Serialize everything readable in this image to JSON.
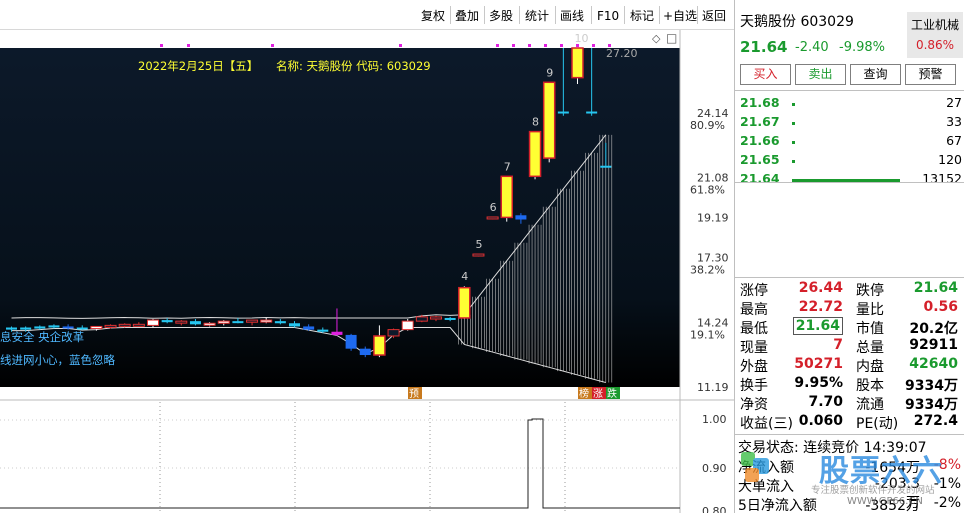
{
  "toolbar": {
    "items": [
      "复权",
      "叠加",
      "多股",
      "统计",
      "画线",
      "F10",
      "标记",
      "+自选",
      "返回"
    ]
  },
  "chart_info": {
    "date": "2022年2月25日【五】",
    "name_code": "名称: 天鹅股份 代码: 603029",
    "note1": "息安全 央企改革",
    "note2": "线进网小心，蓝色忽略",
    "pct_labels": [
      {
        "price": 24.14,
        "pct": "80.9%"
      },
      {
        "price": 21.08,
        "pct": "61.8%"
      },
      {
        "price": 17.3,
        "pct": "38.2%"
      },
      {
        "price": 14.24,
        "pct": "19.1%"
      }
    ],
    "step_labels": [
      "4",
      "5",
      "6",
      "7",
      "8",
      "9",
      "10"
    ],
    "top_price_label": "27.20",
    "bottom_tags": [
      "预",
      "榜",
      "涨",
      "跌"
    ],
    "sub_axis": [
      "1.00",
      "0.90",
      "0.80"
    ]
  },
  "chart_data": {
    "type": "candlestick",
    "title": "2022年2月25日【五】 名称: 天鹅股份 代码: 603029",
    "y_ticks": [
      24.14,
      21.08,
      19.19,
      17.3,
      14.24,
      11.19
    ],
    "ylim": [
      11.19,
      27.2
    ],
    "candles": [
      {
        "o": 14.0,
        "h": 14.05,
        "l": 13.8,
        "c": 13.9,
        "c_type": "cyan"
      },
      {
        "o": 14.0,
        "h": 14.05,
        "l": 13.8,
        "c": 13.9,
        "c_type": "cyan"
      },
      {
        "o": 14.05,
        "h": 14.1,
        "l": 13.9,
        "c": 13.95,
        "c_type": "cyan"
      },
      {
        "o": 14.1,
        "h": 14.15,
        "l": 13.95,
        "c": 14.0,
        "c_type": "cyan"
      },
      {
        "o": 14.05,
        "h": 14.15,
        "l": 13.9,
        "c": 14.05,
        "c_type": "blue"
      },
      {
        "o": 14.0,
        "h": 14.1,
        "l": 13.9,
        "c": 13.95,
        "c_type": "cyan"
      },
      {
        "o": 13.95,
        "h": 14.05,
        "l": 13.85,
        "c": 14.05,
        "c_type": "white"
      },
      {
        "o": 14.05,
        "h": 14.15,
        "l": 13.95,
        "c": 14.1,
        "c_type": "red"
      },
      {
        "o": 14.1,
        "h": 14.2,
        "l": 14.0,
        "c": 14.15,
        "c_type": "red"
      },
      {
        "o": 14.15,
        "h": 14.25,
        "l": 14.05,
        "c": 14.1,
        "c_type": "red"
      },
      {
        "o": 14.1,
        "h": 14.4,
        "l": 14.0,
        "c": 14.35,
        "c_type": "white"
      },
      {
        "o": 14.35,
        "h": 14.45,
        "l": 14.2,
        "c": 14.25,
        "c_type": "cyan"
      },
      {
        "o": 14.25,
        "h": 14.35,
        "l": 14.1,
        "c": 14.3,
        "c_type": "red"
      },
      {
        "o": 14.3,
        "h": 14.4,
        "l": 14.1,
        "c": 14.15,
        "c_type": "cyan"
      },
      {
        "o": 14.15,
        "h": 14.25,
        "l": 14.05,
        "c": 14.2,
        "c_type": "white"
      },
      {
        "o": 14.2,
        "h": 14.35,
        "l": 14.1,
        "c": 14.3,
        "c_type": "white"
      },
      {
        "o": 14.3,
        "h": 14.45,
        "l": 14.2,
        "c": 14.25,
        "c_type": "cyan"
      },
      {
        "o": 14.25,
        "h": 14.35,
        "l": 14.1,
        "c": 14.35,
        "c_type": "red"
      },
      {
        "o": 14.35,
        "h": 14.45,
        "l": 14.2,
        "c": 14.3,
        "c_type": "white"
      },
      {
        "o": 14.3,
        "h": 14.4,
        "l": 14.15,
        "c": 14.2,
        "c_type": "cyan"
      },
      {
        "o": 14.2,
        "h": 14.3,
        "l": 14.0,
        "c": 14.05,
        "c_type": "cyan"
      },
      {
        "o": 14.05,
        "h": 14.15,
        "l": 13.85,
        "c": 13.9,
        "c_type": "blue"
      },
      {
        "o": 13.9,
        "h": 14.0,
        "l": 13.75,
        "c": 13.8,
        "c_type": "cyan"
      },
      {
        "o": 13.8,
        "h": 14.9,
        "l": 13.6,
        "c": 13.65,
        "c_type": "magenta"
      },
      {
        "o": 13.65,
        "h": 13.7,
        "l": 12.9,
        "c": 13.0,
        "c_type": "blue"
      },
      {
        "o": 13.0,
        "h": 13.1,
        "l": 12.6,
        "c": 12.7,
        "c_type": "blue"
      },
      {
        "o": 12.7,
        "h": 14.1,
        "l": 12.6,
        "c": 13.6,
        "c_type": "yellow"
      },
      {
        "o": 13.6,
        "h": 13.95,
        "l": 13.5,
        "c": 13.9,
        "c_type": "red"
      },
      {
        "o": 13.9,
        "h": 14.4,
        "l": 13.85,
        "c": 14.3,
        "c_type": "white"
      },
      {
        "o": 14.3,
        "h": 14.6,
        "l": 14.25,
        "c": 14.5,
        "c_type": "red"
      },
      {
        "o": 14.5,
        "h": 14.55,
        "l": 14.3,
        "c": 14.4,
        "c_type": "red"
      },
      {
        "o": 14.4,
        "h": 14.5,
        "l": 14.3,
        "c": 14.45,
        "c_type": "cyan"
      },
      {
        "o": 14.45,
        "h": 15.95,
        "l": 14.4,
        "c": 15.88,
        "c_type": "yellow"
      },
      {
        "o": 17.47,
        "h": 17.47,
        "l": 17.35,
        "c": 17.47,
        "c_type": "red"
      },
      {
        "o": 19.2,
        "h": 19.22,
        "l": 19.1,
        "c": 19.22,
        "c_type": "red"
      },
      {
        "o": 19.2,
        "h": 21.14,
        "l": 19.0,
        "c": 21.14,
        "c_type": "yellow"
      },
      {
        "o": 19.1,
        "h": 19.4,
        "l": 18.9,
        "c": 19.3,
        "c_type": "blue"
      },
      {
        "o": 21.14,
        "h": 23.25,
        "l": 21.0,
        "c": 23.25,
        "c_type": "yellow"
      },
      {
        "o": 22.0,
        "h": 25.58,
        "l": 21.8,
        "c": 25.58,
        "c_type": "yellow"
      },
      {
        "o": 24.2,
        "h": 27.2,
        "l": 24.0,
        "c": 24.2,
        "c_type": "cyan"
      },
      {
        "o": 25.8,
        "h": 27.2,
        "l": 25.5,
        "c": 27.2,
        "c_type": "yellow"
      },
      {
        "o": 24.2,
        "h": 27.2,
        "l": 24.0,
        "c": 24.2,
        "c_type": "cyan"
      },
      {
        "o": 21.64,
        "h": 22.72,
        "l": 21.64,
        "c": 21.64,
        "c_type": "cyan"
      }
    ],
    "volume_note": "sub-panel shows a tall bar near the recent candles"
  },
  "stock": {
    "name": "天鹅股份",
    "code": "603029",
    "price": "21.64",
    "change": "-2.40",
    "change_pct": "-9.98%",
    "industry": "工业机械",
    "industry_pct": "0.86%",
    "buttons": [
      "买入",
      "卖出",
      "查询",
      "预警"
    ]
  },
  "bids": [
    {
      "price": "21.68",
      "vol": "27",
      "bar": 3
    },
    {
      "price": "21.67",
      "vol": "33",
      "bar": 3
    },
    {
      "price": "21.66",
      "vol": "67",
      "bar": 3
    },
    {
      "price": "21.65",
      "vol": "120",
      "bar": 3
    },
    {
      "price": "21.64",
      "vol": "13152",
      "bar": 108
    }
  ],
  "stats": [
    {
      "l1": "涨停",
      "v1": "26.44",
      "c1": "red",
      "l2": "跌停",
      "v2": "21.64",
      "c2": "green"
    },
    {
      "l1": "最高",
      "v1": "22.72",
      "c1": "red",
      "l2": "量比",
      "v2": "0.56",
      "c2": "red"
    },
    {
      "l1": "最低",
      "v1": "21.64",
      "c1": "green",
      "l2": "市值",
      "v2": "20.2亿",
      "c2": "blk"
    },
    {
      "l1": "现量",
      "v1": "7",
      "c1": "red",
      "l2": "总量",
      "v2": "92911",
      "c2": "blk"
    },
    {
      "l1": "外盘",
      "v1": "50271",
      "c1": "red",
      "l2": "内盘",
      "v2": "42640",
      "c2": "green"
    },
    {
      "l1": "换手",
      "v1": "9.95%",
      "c1": "blk",
      "l2": "股本",
      "v2": "9334万",
      "c2": "blk"
    },
    {
      "l1": "净资",
      "v1": "7.70",
      "c1": "blk",
      "l2": "流通",
      "v2": "9334万",
      "c2": "blk"
    },
    {
      "l1": "收益(三)",
      "v1": "0.060",
      "c1": "blk",
      "l2": "PE(动)",
      "v2": "272.4",
      "c2": "blk"
    }
  ],
  "footer": {
    "status_label": "交易状态:",
    "status_value": "连续竞价",
    "time": "14:39:07",
    "rows": [
      {
        "label": "净流入额",
        "value": "-1654万",
        "pct": "-8%"
      },
      {
        "label": "大单流入",
        "value": "-203.3万",
        "pct": "-1%"
      },
      {
        "label": "5日净流入额",
        "value": "-3852万",
        "pct": "-2%"
      }
    ],
    "watermark": "股票六六",
    "watermark_sub": "专注股票创新软件开发的网站",
    "watermark_url": "WWW.GP66.CN"
  }
}
